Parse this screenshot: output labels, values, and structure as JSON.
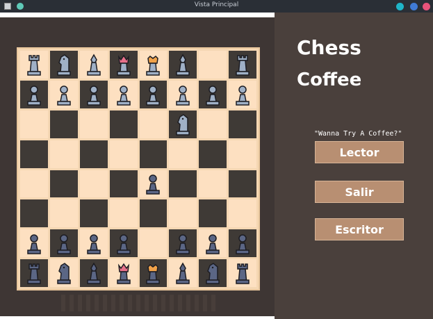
{
  "window": {
    "title": "Vista Principal"
  },
  "app": {
    "title_line1": "Chess",
    "title_line2": "Coffee",
    "tagline": "\"Wanna Try A Coffee?\""
  },
  "buttons": {
    "lector": "Lector",
    "salir": "Salir",
    "escritor": "Escritor"
  },
  "board": {
    "rows": [
      [
        "black-rook",
        "black-knight",
        "black-bishop",
        "black-queen",
        "black-king",
        "black-bishop",
        "",
        "black-rook"
      ],
      [
        "black-pawn",
        "black-pawn",
        "black-pawn",
        "black-pawn",
        "black-pawn",
        "black-pawn",
        "black-pawn",
        "black-pawn"
      ],
      [
        "",
        "",
        "",
        "",
        "",
        "black-knight",
        "",
        ""
      ],
      [
        "",
        "",
        "",
        "",
        "",
        "",
        "",
        ""
      ],
      [
        "",
        "",
        "",
        "",
        "white-pawn",
        "",
        "",
        ""
      ],
      [
        "",
        "",
        "",
        "",
        "",
        "",
        "",
        ""
      ],
      [
        "white-pawn",
        "white-pawn",
        "white-pawn",
        "white-pawn",
        "",
        "white-pawn",
        "white-pawn",
        "white-pawn"
      ],
      [
        "white-rook",
        "white-knight",
        "white-bishop",
        "white-queen",
        "white-king",
        "white-bishop",
        "white-knight",
        "white-rook"
      ]
    ]
  },
  "colors": {
    "black_piece": "#9fb0c6",
    "white_piece": "#5b6685",
    "piece_outline": "#1c1c22",
    "crown_accent": "#f0a24a",
    "queen_accent": "#e7708a"
  }
}
